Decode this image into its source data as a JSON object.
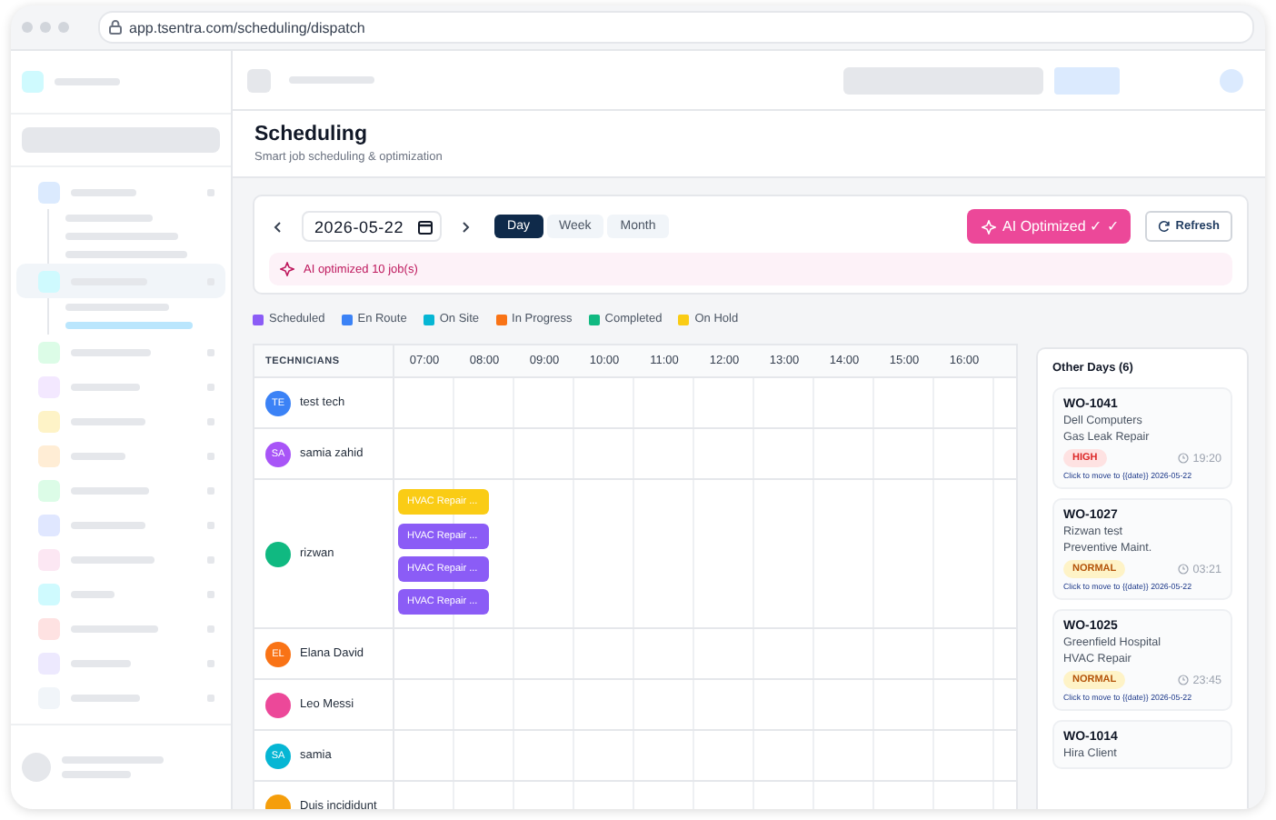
{
  "browser": {
    "url": "app.tsentra.com/scheduling/dispatch"
  },
  "header": {
    "title": "Scheduling",
    "subtitle": "Smart job scheduling & optimization"
  },
  "toolbar": {
    "date": "2026-05-22",
    "views": [
      {
        "label": "Day",
        "selected": true
      },
      {
        "label": "Week",
        "selected": false
      },
      {
        "label": "Month",
        "selected": false
      }
    ],
    "ai_button": "AI Optimized ✓ ✓",
    "refresh_button": "Refresh",
    "banner": "AI optimized 10 job(s)"
  },
  "legend": [
    {
      "label": "Scheduled",
      "color": "#8b5cf6"
    },
    {
      "label": "En Route",
      "color": "#3b82f6"
    },
    {
      "label": "On Site",
      "color": "#06b6d4"
    },
    {
      "label": "In Progress",
      "color": "#f97316"
    },
    {
      "label": "Completed",
      "color": "#10b981"
    },
    {
      "label": "On Hold",
      "color": "#facc15"
    }
  ],
  "grid": {
    "technicians_heading": "TECHNICIANS",
    "hours": [
      "07:00",
      "08:00",
      "09:00",
      "10:00",
      "11:00",
      "12:00",
      "13:00",
      "14:00",
      "15:00",
      "16:00"
    ],
    "technicians": [
      {
        "name": "test tech",
        "initials": "TE",
        "color": "#3b82f6"
      },
      {
        "name": "samia zahid",
        "initials": "SA",
        "color": "#a855f7"
      },
      {
        "name": "rizwan",
        "color": "#10b981",
        "jobs": [
          {
            "label": "HVAC Repair ...",
            "color": "#facc15"
          },
          {
            "label": "HVAC Repair ...",
            "color": "#8b5cf6"
          },
          {
            "label": "HVAC Repair ...",
            "color": "#8b5cf6"
          },
          {
            "label": "HVAC Repair ...",
            "color": "#8b5cf6"
          }
        ]
      },
      {
        "name": "Elana David",
        "initials": "EL",
        "color": "#f97316"
      },
      {
        "name": "Leo Messi",
        "color": "#ec4899"
      },
      {
        "name": "samia",
        "initials": "SA",
        "color": "#06b6d4"
      },
      {
        "name": "Duis incididunt",
        "color": "#f59e0b"
      }
    ]
  },
  "other_days": {
    "title": "Other Days (6)",
    "orders": [
      {
        "id": "WO-1041",
        "client": "Dell Computers",
        "service": "Gas Leak Repair",
        "priority": "HIGH",
        "kind": "high",
        "time": "19:20",
        "hint": "Click to move to {{date}} 2026-05-22"
      },
      {
        "id": "WO-1027",
        "client": "Rizwan test",
        "service": "Preventive Maint.",
        "priority": "NORMAL",
        "kind": "normal",
        "time": "03:21",
        "hint": "Click to move to {{date}} 2026-05-22"
      },
      {
        "id": "WO-1025",
        "client": "Greenfield Hospital",
        "service": "HVAC Repair",
        "priority": "NORMAL",
        "kind": "normal",
        "time": "23:45",
        "hint": "Click to move to {{date}} 2026-05-22"
      },
      {
        "id": "WO-1014",
        "client": "Hira Client"
      }
    ]
  }
}
